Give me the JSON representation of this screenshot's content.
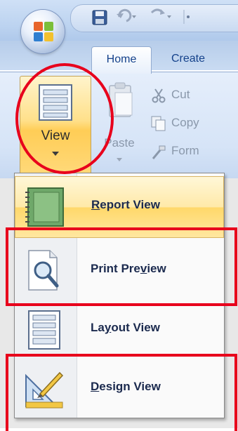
{
  "ribbon": {
    "tabs": [
      {
        "label": "Home",
        "active": true
      },
      {
        "label": "Create",
        "active": false
      }
    ],
    "view_button": {
      "label": "View",
      "icon": "view-layout-icon"
    },
    "clipboard": {
      "paste_label": "Paste",
      "cut_label": "Cut",
      "copy_label": "Copy",
      "format_label": "Form"
    }
  },
  "view_menu": {
    "items": [
      {
        "label": "Report View",
        "access_key": "R",
        "icon": "report-view-icon",
        "highlighted": true
      },
      {
        "label": "Print Preview",
        "access_key": "v",
        "icon": "print-preview-icon",
        "highlighted": false
      },
      {
        "label": "Layout View",
        "access_key": "y",
        "icon": "layout-view-icon",
        "highlighted": false
      },
      {
        "label": "Design View",
        "access_key": "D",
        "icon": "design-view-icon",
        "highlighted": false
      }
    ]
  },
  "colors": {
    "annotation_red": "#e8001c",
    "highlight_gold": "#ffd86a",
    "ribbon_blue": "#cfe0f6",
    "tab_text": "#15428b",
    "menu_text": "#1b2a4e"
  }
}
